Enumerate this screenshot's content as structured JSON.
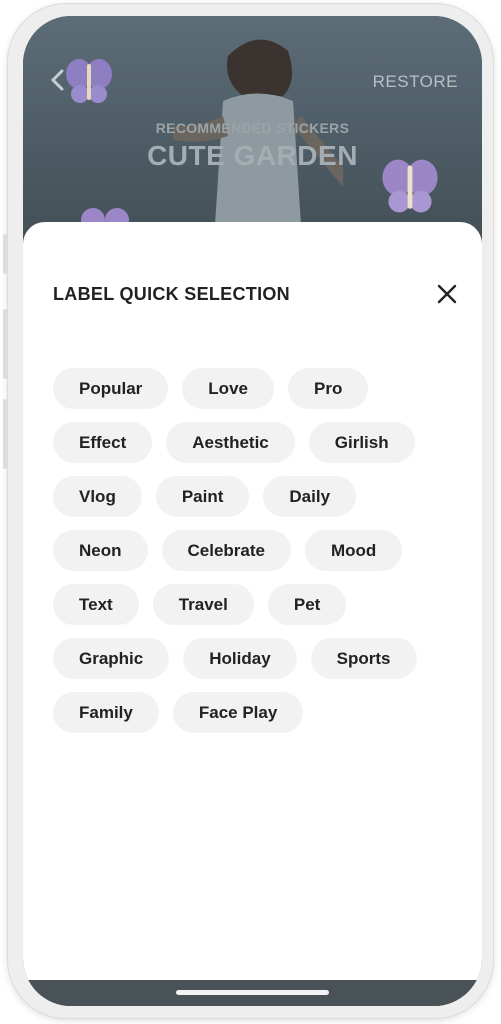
{
  "hero": {
    "restore_label": "RESTORE",
    "subtitle": "RECOMMENDED STICKERS",
    "title": "CUTE GARDEN"
  },
  "sheet": {
    "title": "LABEL QUICK SELECTION",
    "chip_rows": [
      [
        "Popular",
        "Love",
        "Pro"
      ],
      [
        "Effect",
        "Aesthetic",
        "Girlish"
      ],
      [
        "Vlog",
        "Paint",
        "Daily"
      ],
      [
        "Neon",
        "Celebrate",
        "Mood"
      ],
      [
        "Text",
        "Travel",
        "Pet"
      ],
      [
        "Graphic",
        "Holiday",
        "Sports"
      ],
      [
        "Family",
        "Face Play"
      ]
    ]
  },
  "colors": {
    "chip_bg": "#f2f2f2",
    "hero_bg": "#4c5b64",
    "butterfly": "#9b87c7"
  },
  "icons": {
    "back": "chevron-left-icon",
    "close": "close-icon",
    "sticker": "butterfly-icon"
  }
}
